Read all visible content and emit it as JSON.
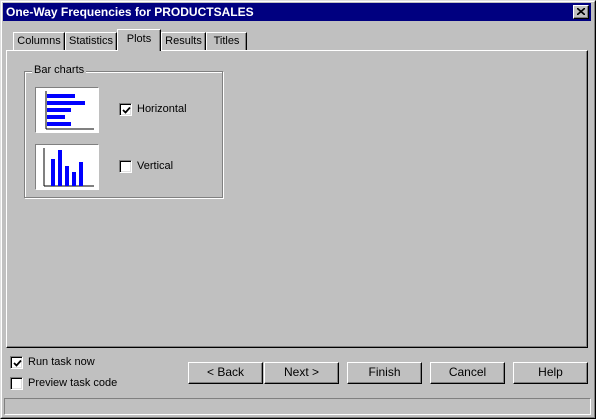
{
  "window": {
    "title": "One-Way Frequencies for PRODUCTSALES"
  },
  "tabs": [
    {
      "label": "Columns",
      "active": false
    },
    {
      "label": "Statistics",
      "active": false
    },
    {
      "label": "Plots",
      "active": true
    },
    {
      "label": "Results",
      "active": false
    },
    {
      "label": "Titles",
      "active": false
    }
  ],
  "bar_charts": {
    "legend": "Bar charts",
    "options": [
      {
        "label": "Horizontal",
        "checked": true,
        "icon": "horizontal-bar-chart-icon"
      },
      {
        "label": "Vertical",
        "checked": false,
        "icon": "vertical-bar-chart-icon"
      }
    ]
  },
  "footer": {
    "run_task_now": {
      "label": "Run task now",
      "checked": true
    },
    "preview_task_code": {
      "label": "Preview task code",
      "checked": false
    }
  },
  "buttons": {
    "back": "< Back",
    "next": "Next >",
    "finish": "Finish",
    "cancel": "Cancel",
    "help": "Help"
  },
  "colors": {
    "title_bar": "#000080",
    "face": "#c0c0c0",
    "chart_bars": "#0000ff"
  }
}
